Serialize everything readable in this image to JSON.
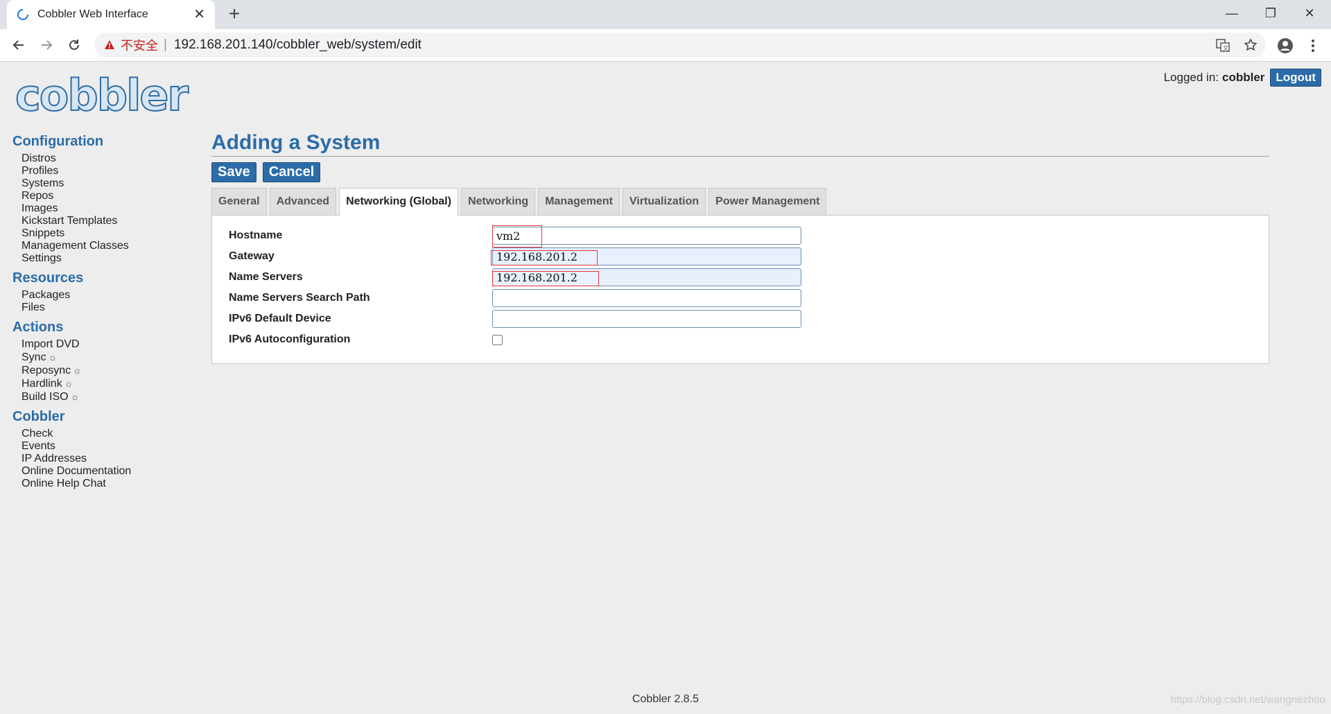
{
  "browser": {
    "tab_title": "Cobbler Web Interface",
    "tab_close": "✕",
    "new_tab": "+",
    "insecure_label": "不安全",
    "separator": "|",
    "url": "192.168.201.140/cobbler_web/system/edit",
    "window_controls": {
      "minimize": "—",
      "maximize": "❐",
      "close": "✕"
    }
  },
  "header": {
    "logo_text": "cobbler",
    "logged_in_label": "Logged in:",
    "username": "cobbler",
    "logout_label": "Logout"
  },
  "sidebar": {
    "sections": [
      {
        "heading": "Configuration",
        "items": [
          "Distros",
          "Profiles",
          "Systems",
          "Repos",
          "Images",
          "Kickstart Templates",
          "Snippets",
          "Management Classes",
          "Settings"
        ]
      },
      {
        "heading": "Resources",
        "items": [
          "Packages",
          "Files"
        ]
      },
      {
        "heading": "Actions",
        "items": [
          "Import DVD",
          "Sync",
          "Reposync",
          "Hardlink",
          "Build ISO"
        ],
        "gear_items": [
          "Sync",
          "Reposync",
          "Hardlink",
          "Build ISO"
        ]
      },
      {
        "heading": "Cobbler",
        "items": [
          "Check",
          "Events",
          "IP Addresses",
          "Online Documentation",
          "Online Help Chat"
        ]
      }
    ],
    "gear_symbol": "☼"
  },
  "main": {
    "title": "Adding a System",
    "save_label": "Save",
    "cancel_label": "Cancel",
    "tabs": [
      "General",
      "Advanced",
      "Networking (Global)",
      "Networking",
      "Management",
      "Virtualization",
      "Power Management"
    ],
    "active_tab": "Networking (Global)",
    "fields": {
      "hostname": {
        "label": "Hostname",
        "value": "vm2"
      },
      "gateway": {
        "label": "Gateway",
        "value": "192.168.201.2"
      },
      "name_servers": {
        "label": "Name Servers",
        "value": "192.168.201.2"
      },
      "search_path": {
        "label": "Name Servers Search Path",
        "value": ""
      },
      "ipv6_default_device": {
        "label": "IPv6 Default Device",
        "value": ""
      },
      "ipv6_autoconfiguration": {
        "label": "IPv6 Autoconfiguration",
        "checked": false
      }
    }
  },
  "footer": {
    "version": "Cobbler 2.8.5"
  },
  "watermark": "https://blog.csdn.net/wangnezhou",
  "colors": {
    "accent": "#2b6ca8",
    "highlight": "#e53935",
    "autofill": "#e8f0fe"
  }
}
